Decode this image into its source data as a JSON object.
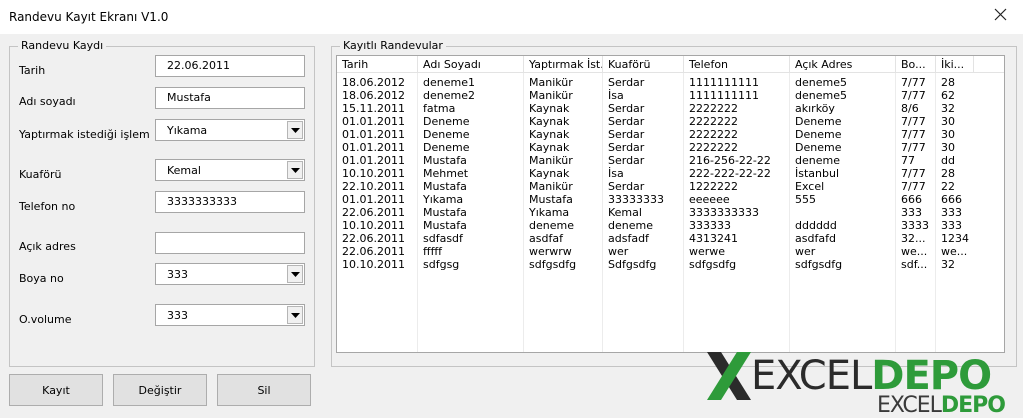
{
  "window": {
    "title": "Randevu Kayıt Ekranı V1.0"
  },
  "form": {
    "group_title": "Randevu Kaydı",
    "tarih": {
      "label": "Tarih",
      "value": "22.06.2011"
    },
    "adsoyad": {
      "label": "Adı soyadı",
      "value": "Mustafa"
    },
    "islem": {
      "label": "Yaptırmak istediği işlem",
      "value": "Yıkama"
    },
    "kuafor": {
      "label": "Kuaförü",
      "value": "Kemal"
    },
    "telefon": {
      "label": "Telefon no",
      "value": "3333333333"
    },
    "adres": {
      "label": "Açık adres",
      "value": ""
    },
    "boya": {
      "label": "Boya no",
      "value": "333"
    },
    "ovolume": {
      "label": "O.volume",
      "value": "333"
    }
  },
  "list": {
    "group_title": "Kayıtlı Randevular",
    "columns": [
      "Tarih",
      "Adı Soyadı",
      "Yaptırmak İst.",
      "Kuaförü",
      "Telefon",
      "Açık Adres",
      "Bo...",
      "İki..."
    ],
    "rows": [
      [
        "18.06.2012",
        "deneme1",
        "Manikür",
        "Serdar",
        "1111111111",
        "deneme5",
        "7/77",
        "28"
      ],
      [
        "18.06.2012",
        "deneme2",
        "Manikür",
        "İsa",
        "1111111111",
        "deneme5",
        "7/77",
        "62"
      ],
      [
        "15.11.2011",
        "fatma",
        "Kaynak",
        "Serdar",
        "2222222",
        "akırköy",
        "8/6",
        "32"
      ],
      [
        "01.01.2011",
        "Deneme",
        "Kaynak",
        "Serdar",
        "2222222",
        "Deneme",
        "7/77",
        "30"
      ],
      [
        "01.01.2011",
        "Deneme",
        "Kaynak",
        "Serdar",
        "2222222",
        "Deneme",
        "7/77",
        "30"
      ],
      [
        "01.01.2011",
        "Deneme",
        "Kaynak",
        "Serdar",
        "2222222",
        "Deneme",
        "7/77",
        "30"
      ],
      [
        "01.01.2011",
        "Mustafa",
        "Manikür",
        "Serdar",
        "216-256-22-22",
        "deneme",
        "77",
        "dd"
      ],
      [
        "10.10.2011",
        "Mehmet",
        "Kaynak",
        "İsa",
        "222-222-22-22",
        "İstanbul",
        "7/77",
        "28"
      ],
      [
        "22.10.2011",
        "Mustafa",
        "Manikür",
        "Serdar",
        "1222222",
        "Excel",
        "7/77",
        "22"
      ],
      [
        "01.01.2011",
        "Yıkama",
        "Mustafa",
        "33333333",
        "eeeeee",
        "555",
        "666",
        "666"
      ],
      [
        "22.06.2011",
        "Mustafa",
        "Yıkama",
        "Kemal",
        "3333333333",
        "",
        "333",
        "333"
      ],
      [
        "10.10.2011",
        "Mustafa",
        "deneme",
        "deneme",
        "333333",
        "dddddd",
        "3333",
        "333"
      ],
      [
        "22.06.2011",
        "sdfasdf",
        "asdfaf",
        "adsfadf",
        "4313241",
        "asdfafd",
        "32...",
        "1234"
      ],
      [
        "22.06.2011",
        "fffff",
        "werwrw",
        "wer",
        "werwe",
        "wer",
        "we...",
        "we..."
      ],
      [
        "10.10.2011",
        "sdfgsg",
        "sdfgsdfg",
        "Sdfgsdfg",
        "sdfgsdfg",
        "sdfgsdfg",
        "sdf...",
        "32"
      ]
    ]
  },
  "buttons": {
    "kayit": "Kayıt",
    "degistir": "Değiştir",
    "sil": "Sil"
  },
  "logo": {
    "excel": "EXCEL",
    "depo": "DEPO",
    "colors": {
      "excel": "#2b2b2b",
      "depo": "#2e9b3a"
    }
  }
}
